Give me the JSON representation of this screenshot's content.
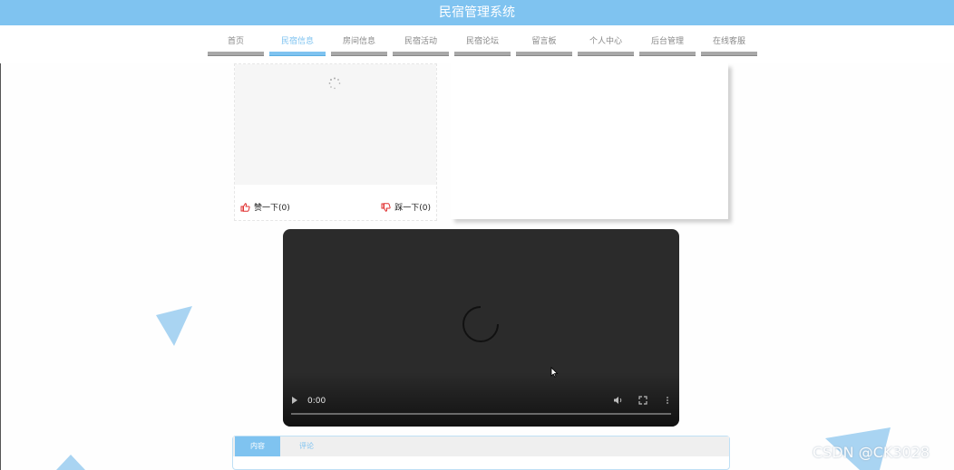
{
  "header": {
    "title": "民宿管理系统"
  },
  "nav": {
    "items": [
      {
        "label": "首页"
      },
      {
        "label": "民宿信息"
      },
      {
        "label": "房间信息"
      },
      {
        "label": "民宿活动"
      },
      {
        "label": "民宿论坛"
      },
      {
        "label": "留言板"
      },
      {
        "label": "个人中心"
      },
      {
        "label": "后台管理"
      },
      {
        "label": "在线客服"
      }
    ],
    "active_index": 1
  },
  "card": {
    "like_label": "赞一下(0)",
    "dislike_label": "踩一下(0)"
  },
  "video": {
    "time": "0:00"
  },
  "tabs": {
    "items": [
      {
        "label": "内容"
      },
      {
        "label": "评论"
      }
    ]
  },
  "watermark": "CSDN @CK3028",
  "colors": {
    "accent": "#7fc3f0",
    "vote_icon": "#e03030",
    "video_bg": "#2b2b2b"
  }
}
